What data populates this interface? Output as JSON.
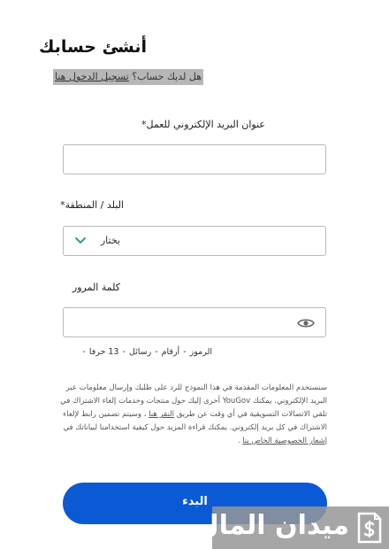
{
  "title": "أنشئ حسابك",
  "login": {
    "prompt": "هل لديك حساب؟",
    "link": "تسجيل الدخول هنا"
  },
  "email": {
    "label": "عنوان البريد الإلكتروني للعمل*",
    "value": "",
    "placeholder": ""
  },
  "country": {
    "label": "البلد / المنطقة*",
    "selected": "يختار",
    "icon": "chevron-down-icon"
  },
  "password": {
    "label": "كلمة المرور",
    "value": "",
    "icon": "eye-icon"
  },
  "password_hints": [
    "13 حرفا",
    "رسائل",
    "أرقام",
    "الرموز"
  ],
  "disclaimer": {
    "part1": "سنستخدم المعلومات المقدمة في هذا النموذج للرد على طلبك وإرسال معلومات عبر البريد الإلكتروني. يمكنك YouGov أخرى إليك حول منتجات وخدمات إلغاء الاشتراك في تلقي الاتصالات التسويقية في أي وقت عن طريق",
    "link1": "النقر هنا",
    "part2": "، وسيتم تضمين رابط لإلغاء الاشتراك في كل بريد إلكتروني. يمكنك قراءة المزيد حول كيفية استخدامنا لبياناتك في",
    "link2": "إشعار الخصوصية الخاص بنا",
    "part3": "."
  },
  "start_button": "البدء",
  "watermark": {
    "text": "ميدان المال",
    "icon": "dollar-document-icon"
  },
  "colors": {
    "primary": "#0b5ad5",
    "highlight": "#b7b7b7",
    "watermark": "#969696"
  }
}
